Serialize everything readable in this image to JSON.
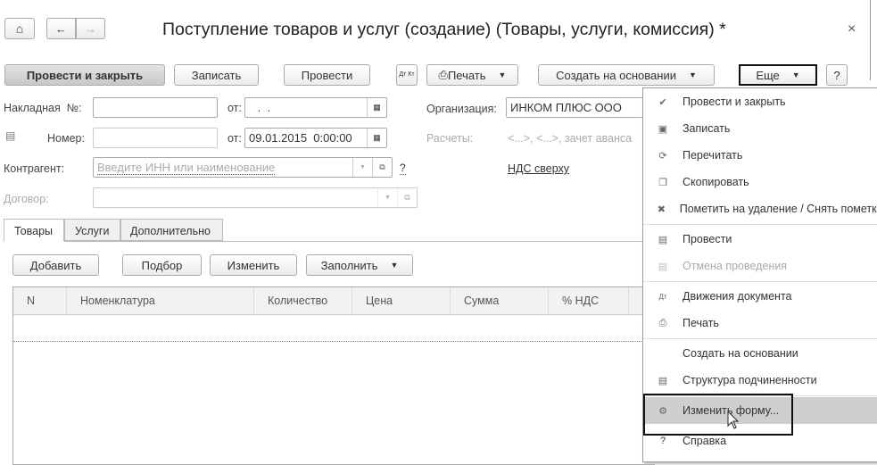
{
  "header": {
    "title": "Поступление товаров и услуг (создание) (Товары, услуги, комиссия) *",
    "home_icon": "home-icon",
    "back_icon": "arrow-left-icon",
    "forward_icon": "arrow-right-icon",
    "close": "×"
  },
  "toolbar": {
    "post_close": "Провести и закрыть",
    "save": "Записать",
    "post": "Провести",
    "dtkt": "Дт Кт",
    "print": "Печать",
    "create_based": "Создать на основании",
    "more": "Еще",
    "help": "?"
  },
  "form": {
    "invoice_label": "Накладная  №:",
    "invoice_value": "",
    "from1": "от:",
    "date1": " .  .",
    "number_label": "Номер:",
    "from2": "от:",
    "date2": "09.01.2015  0:00:00",
    "counterparty_label": "Контрагент:",
    "counterparty_placeholder": "Введите ИНН или наименование",
    "q": "?",
    "contract_label": "Договор:",
    "org_label": "Организация:",
    "org_value": "ИНКОМ ПЛЮС ООО",
    "calc_label": "Расчеты:",
    "calc_value": "<...>, <...>, зачет аванса",
    "vat_link": "НДС сверху"
  },
  "tabs": [
    "Товары",
    "Услуги",
    "Дополнительно"
  ],
  "table_toolbar": {
    "add": "Добавить",
    "pick": "Подбор",
    "edit": "Изменить",
    "fill": "Заполнить"
  },
  "table": {
    "columns": [
      "N",
      "Номенклатура",
      "Количество",
      "Цена",
      "Сумма",
      "% НДС"
    ]
  },
  "menu": {
    "items": [
      {
        "label": "Провести и закрыть",
        "icon": "✔"
      },
      {
        "label": "Записать",
        "icon": "▣"
      },
      {
        "label": "Перечитать",
        "icon": "⟳"
      },
      {
        "label": "Скопировать",
        "icon": "❐"
      },
      {
        "label": "Пометить на удаление / Снять пометку",
        "icon": "✖"
      },
      {
        "label": "Провести",
        "icon": "▤"
      },
      {
        "label": "Отмена проведения",
        "icon": "▤"
      },
      {
        "label": "Движения документа",
        "icon": "Дт"
      },
      {
        "label": "Печать",
        "icon": "⎙"
      },
      {
        "label": "Создать на основании",
        "icon": ""
      },
      {
        "label": "Структура подчиненности",
        "icon": "▤"
      },
      {
        "label": "Изменить форму...",
        "icon": "⚙"
      },
      {
        "label": "Справка",
        "icon": "?"
      }
    ]
  }
}
